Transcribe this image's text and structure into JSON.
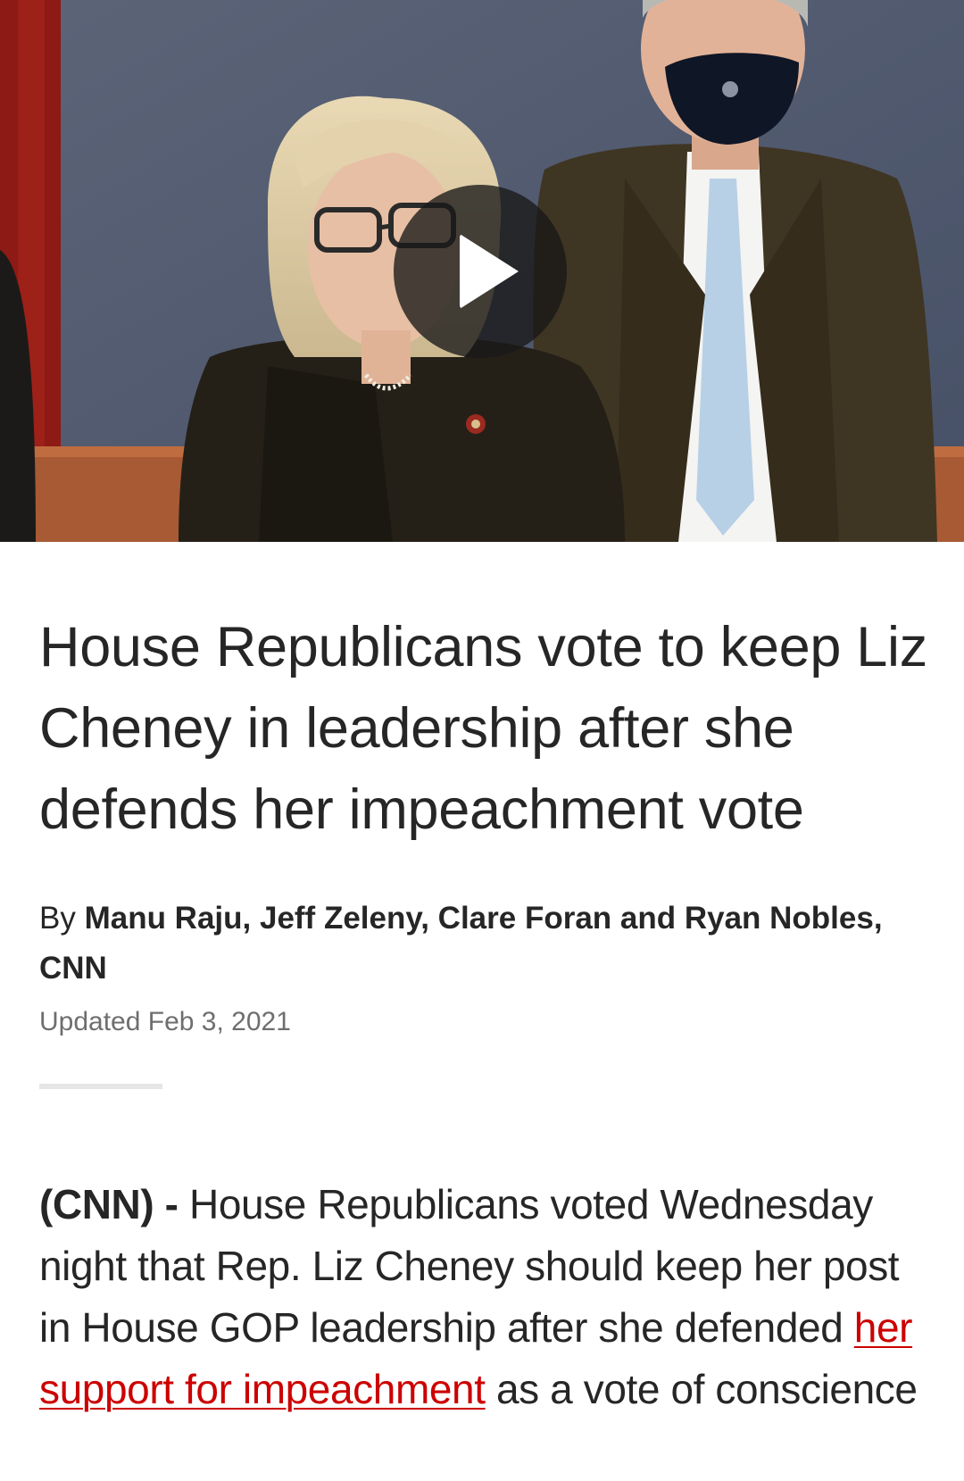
{
  "video": {
    "play_icon": "play-icon"
  },
  "article": {
    "headline": "House Republicans vote to keep Liz Cheney in leadership after she defends her impeachment vote",
    "byline_prefix": "By ",
    "byline_authors": "Manu Raju, Jeff Zeleny, Clare Foran and Ryan Nobles, CNN",
    "updated_label": "Updated",
    "updated_date": "Feb 3, 2021",
    "body": {
      "source_tag": "(CNN) -",
      "text_before_link": "House Republicans voted Wednesday night that Rep. Liz Cheney should keep her post in House GOP leadership after she defended",
      "link_text": "her support for impeachment",
      "text_after_link": "as a vote of conscience"
    }
  },
  "colors": {
    "link": "#cc0000",
    "text": "#262626",
    "muted": "#6e6e6e"
  }
}
